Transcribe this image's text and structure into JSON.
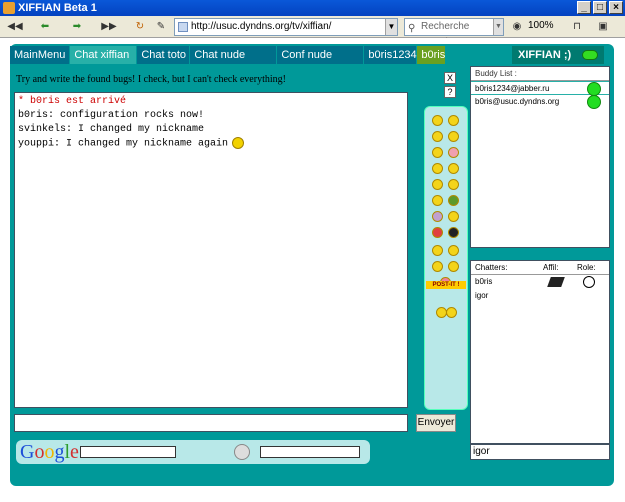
{
  "window": {
    "title": "XIFFIAN Beta 1"
  },
  "browser": {
    "url": "http://usuc.dyndns.org/tv/xiffian/",
    "search_placeholder": "Recherche Google",
    "zoom": "100%"
  },
  "tabs": [
    {
      "label": "MainMenu"
    },
    {
      "label": "Chat xiffian"
    },
    {
      "label": "Chat toto"
    },
    {
      "label": "Chat nude"
    },
    {
      "label": "Conf nude"
    },
    {
      "label": "b0ris1234"
    },
    {
      "label": "b0ris"
    }
  ],
  "brand": {
    "label": "XIFFIAN ;)"
  },
  "notice": "Try and write the found bugs! I check, but I can't check everything!",
  "panel_buttons": {
    "close": "X",
    "help": "?"
  },
  "chat": {
    "messages": [
      {
        "text": "* b0ris est arrivé"
      },
      {
        "text": "b0ris: configuration rocks now!"
      },
      {
        "text": "svinkels: I changed my nickname"
      },
      {
        "text": "youppi: I changed my nickname again"
      }
    ]
  },
  "emoticons": {
    "postit_label": "POST-IT !"
  },
  "buddy_list": {
    "header": "Buddy List :",
    "items": [
      {
        "jid": "b0ris1234@jabber.ru",
        "status": "online"
      },
      {
        "jid": "b0ris@usuc.dyndns.org",
        "status": "online"
      }
    ]
  },
  "chatters": {
    "headers": {
      "name": "Chatters:",
      "affil": "Affil:",
      "role": "Role:"
    },
    "rows": [
      {
        "name": "b0ris"
      },
      {
        "name": "igor"
      }
    ]
  },
  "nick_input_value": "igor",
  "send_button": "Envoyer",
  "google_bar": {
    "logo": "Google"
  },
  "colors": {
    "app_bg": "#009999",
    "tab_bg": "#006f8a",
    "tab_selected": "#27b0a8",
    "online": "#22dd22",
    "system_message": "#cc0000"
  }
}
